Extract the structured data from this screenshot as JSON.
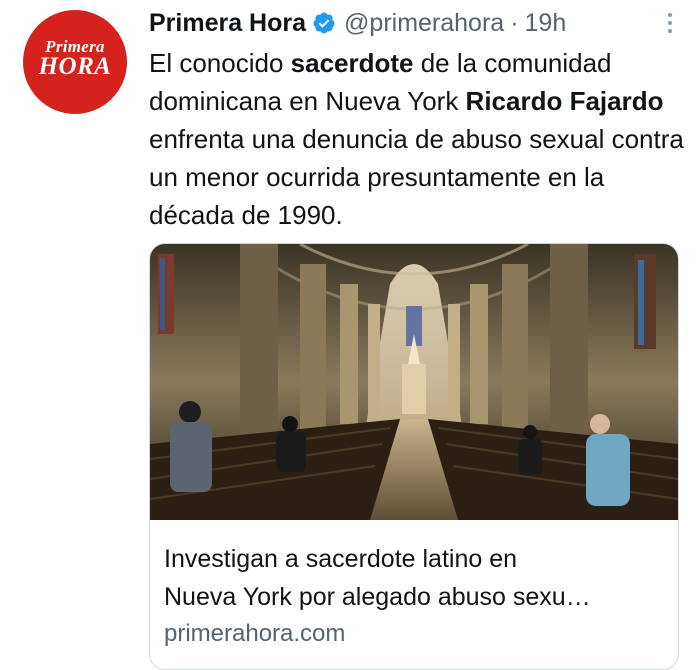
{
  "account": {
    "logo_line1": "Primera",
    "logo_line2": "HORA",
    "name": "Primera Hora",
    "handle": "@primerahora",
    "separator": "·",
    "time": "19h",
    "verified": true
  },
  "tweet": {
    "segments": [
      {
        "text": "El conocido ",
        "bold": false
      },
      {
        "text": "sacerdote",
        "bold": true
      },
      {
        "text": " de la comunidad dominicana en Nueva York ",
        "bold": false
      },
      {
        "text": "Ricardo Fajardo",
        "bold": true
      },
      {
        "text": " enfrenta una denuncia de abuso sexual contra un menor ocurrida presuntamente en la década de 1990.",
        "bold": false
      }
    ]
  },
  "card": {
    "title_line1": "Investigan a sacerdote latino en",
    "title_line2": "Nueva York por alegado abuso sexu…",
    "domain": "primerahora.com"
  },
  "colors": {
    "brand_red": "#d5221c",
    "verified_blue": "#1d9bf0",
    "secondary_text": "#536471",
    "border": "#cfd9de"
  },
  "icons": {
    "verified": "verified-badge-icon",
    "more": "more-options-icon"
  }
}
